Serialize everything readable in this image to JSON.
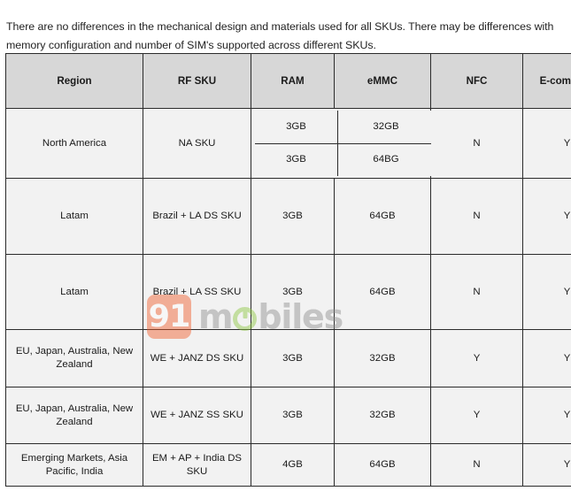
{
  "intro": {
    "paragraph": "There are no differences in the mechanical design and materials used for all SKUs. There may be differences with memory configuration and number of SIM's supported across different SKUs."
  },
  "table": {
    "columns": [
      "Region",
      "RF SKU",
      "RAM",
      "eMMC",
      "NFC",
      "E-compass"
    ],
    "rows": [
      {
        "region": "North America",
        "rf_sku": "NA SKU",
        "split": true,
        "ram": [
          "3GB",
          "3GB"
        ],
        "emmc": [
          "32GB",
          "64BG"
        ],
        "nfc": "N",
        "ecompass": "Y"
      },
      {
        "region": "Latam",
        "rf_sku": "Brazil + LA DS SKU",
        "split": false,
        "ram": "3GB",
        "emmc": "64GB",
        "nfc": "N",
        "ecompass": "Y"
      },
      {
        "region": "Latam",
        "rf_sku": "Brazil + LA SS SKU",
        "split": false,
        "ram": "3GB",
        "emmc": "64GB",
        "nfc": "N",
        "ecompass": "Y"
      },
      {
        "region": "EU, Japan, Australia, New Zealand",
        "rf_sku": "WE + JANZ DS SKU",
        "split": false,
        "ram": "3GB",
        "emmc": "32GB",
        "nfc": "Y",
        "ecompass": "Y"
      },
      {
        "region": "EU, Japan, Australia, New Zealand",
        "rf_sku": "WE + JANZ SS SKU",
        "split": false,
        "ram": "3GB",
        "emmc": "32GB",
        "nfc": "Y",
        "ecompass": "Y"
      },
      {
        "region": "Emerging Markets, Asia Pacific, India",
        "rf_sku": "EM + AP + India DS SKU",
        "split": false,
        "ram": "4GB",
        "emmc": "64GB",
        "nfc": "N",
        "ecompass": "Y"
      }
    ]
  },
  "watermark": {
    "badge": "91",
    "text_before": "m",
    "text_after": "biles",
    "badge_color": "#f05a28",
    "text_color": "#8d8d8d",
    "accent_color": "#8cc63e"
  }
}
